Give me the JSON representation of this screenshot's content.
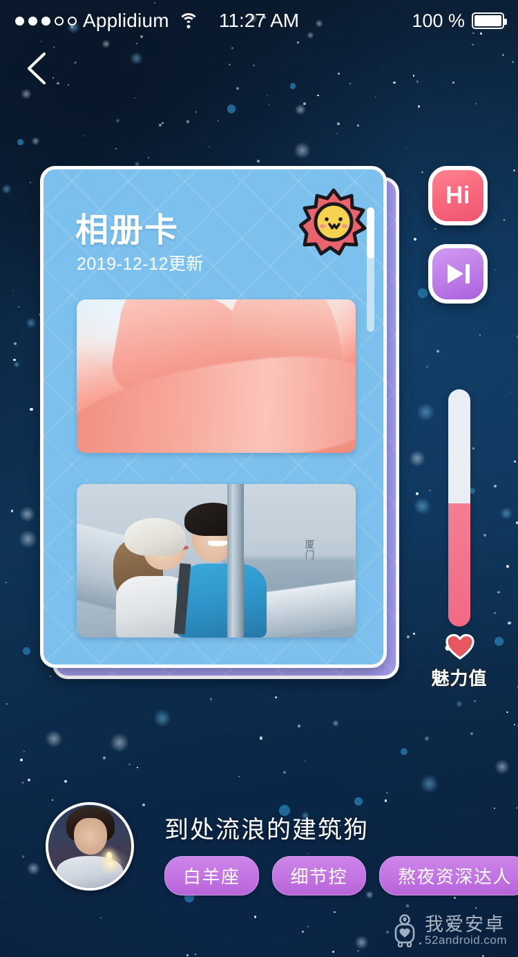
{
  "status_bar": {
    "signal_dots_filled": 3,
    "signal_dots_total": 5,
    "carrier": "Applidium",
    "wifi_icon": "wifi-icon",
    "time": "11:27 AM",
    "battery_percent": "100 %",
    "battery_icon": "battery-full-icon"
  },
  "nav": {
    "back_icon": "chevron-left-icon"
  },
  "card": {
    "title": "相册卡",
    "subtitle": "2019-12-12更新",
    "badge_icon": "sun-face-icon",
    "scrollbar": {
      "thumb_percent": 41
    },
    "photos": [
      {
        "name": "photo-girl-coral-fabric",
        "caption": ""
      },
      {
        "name": "photo-couple-bridge",
        "caption": "厦门"
      }
    ],
    "front_color": "#7cc0ed",
    "back_color": "#a39cf0"
  },
  "actions": {
    "hi_label": "Hi",
    "hi_color": "#f96a7e",
    "next_icon": "skip-next-icon",
    "next_color": "#c07fe8"
  },
  "charm": {
    "label": "魅力值",
    "heart_icon": "heart-icon",
    "fill_percent": 52,
    "fill_color": "#f26a85",
    "track_color": "#e8eef3"
  },
  "profile": {
    "avatar_name": "user-avatar",
    "username": "到处流浪的建筑狗",
    "tags": [
      "白羊座",
      "细节控",
      "熬夜资深达人"
    ],
    "tag_color": "#c274e2"
  },
  "watermark": {
    "logo_icon": "robot-logo-icon",
    "cn": "我爱安卓",
    "en": "52android.com"
  }
}
